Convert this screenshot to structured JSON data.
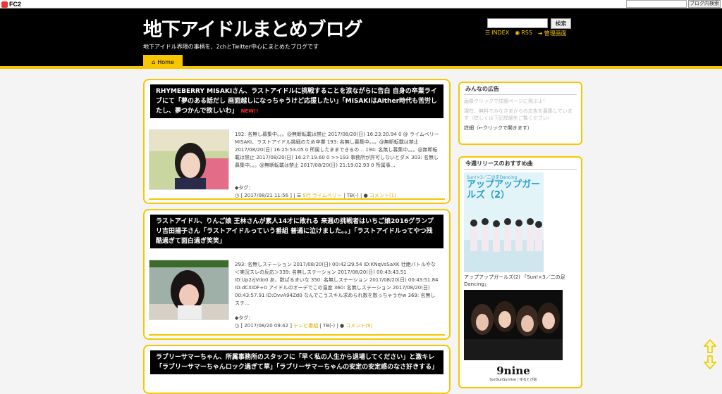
{
  "fc2": {
    "logo": "FC2",
    "search_button": "ブログ内検索"
  },
  "header": {
    "title": "地下アイドルまとめブログ",
    "description": "地下アイドル界隈の事柄を、2chとTwitter中心にまとめたブログです",
    "search_button": "検索",
    "links": [
      {
        "label": "INDEX"
      },
      {
        "label": "RSS"
      },
      {
        "label": "管理画面"
      }
    ]
  },
  "nav": {
    "home": "Home"
  },
  "posts": [
    {
      "title": "RHYMEBERRY MISAKIさん、ラストアイドルに挑戦することを涙ながらに告白 自身の卒業ライブにて「夢のある話だし 画面越しになっちゃうけど応援したい」「MISAKIはAither時代も苦労したし、夢つかんで欲しいわ」",
      "new_badge": "NEW!!",
      "excerpt": "192: 名無し募集中。。。@無断転載は禁止 2017/08/20(日) 16:23:20.94 0 @ ライムベリーMISAKI、ラストアイドル挑戦のため卒業 193: 名無し募集中。。。@無断転載は禁止 2017/08/20(日) 16:25:53.05 0 所属したままできるの… 194: 名無し募集中。。。@無断転載は禁止 2017/08/20(日) 16:27:19.60 0 >>193 事務所が許可しないとダメ 303: 名無し募集中。。。@無断転載は禁止 2017/08/20(日) 21:19:02.93 0 所属事…",
      "tag_label": "タグ：",
      "date": "[ 2017/08/21 11:56 ]",
      "category": "5行 ライムベリー",
      "tb": "TB(-)",
      "comment": "コメント(1)"
    },
    {
      "title": "ラストアイドル、りんご娘 王林さんが素人14才に敗れる 来週の挑戦者はいちご娘2016グランプリ吉田揚子さん「ラストアイドルっていう番組 普通に泣けました。。」「ラストアイドルってやつ残酷過ぎて面白過ぎ笑笑」",
      "new_badge": "",
      "excerpt": "293: 名無しステーション 2017/08/20(日) 00:42:29.54 ID:KNqVsSaXK 壮絶バトルやな ＜実況スレの反応＞339: 名無しステーション 2017/08/20(日) 00:43:43.51 ID:Up2zjVdo0 あ、数ぱるまいな 350: 名無しステーション 2017/08/20(日) 00:43:51.84 ID:dCXIDF+0 アイドルのオーデでこの温度 360: 名無しステーション 2017/08/20(日) 00:43:57.91 ID:DvvA94Zd0 なんでこうスキル求められ数を数っちゃうかw 369: 名無しステ…",
      "tag_label": "タグ：",
      "date": "[ 2017/08/20 09:42 ]",
      "category": "テレビ番組",
      "tb": "TB(-)",
      "comment": "コメント(9)"
    },
    {
      "title": "ラブリーサマーちゃん、所属事務所のスタッフに「早く私の人生から退場してください」と激キレ「ラブリーサマーちゃんロック過ぎて草」「ラブリーサマーちゃんの安定の安定感のなさ好きする」",
      "new_badge": ""
    }
  ],
  "sidebar": {
    "ad_title": "みんなの広告",
    "ad_line1": "画像クリックで詳細ページに飛ぶよ！",
    "ad_line2": "現在、無料でみなさまからの広告を募集しています（詳しくは下記詳細をご覧ください）",
    "ad_detail": "詳細（←クリックで開きます）",
    "release_title": "今週リリースのおすすめ曲",
    "cd1_caption": "アップアップガールズ(2) 「Sun!×3／二の足Dancing」",
    "cd1_cover_text": "アップアップガールズ（2）",
    "cd1_subtitle": "Sun!×3／二の足Dancing",
    "cd2_cover_text": "9nine",
    "cd2_subtitle": "SunSunSunrise / ゆるとぴあ"
  },
  "colors": {
    "accent": "#f7c600",
    "header_bg": "#000000",
    "new_badge": "#ff2a2a"
  }
}
